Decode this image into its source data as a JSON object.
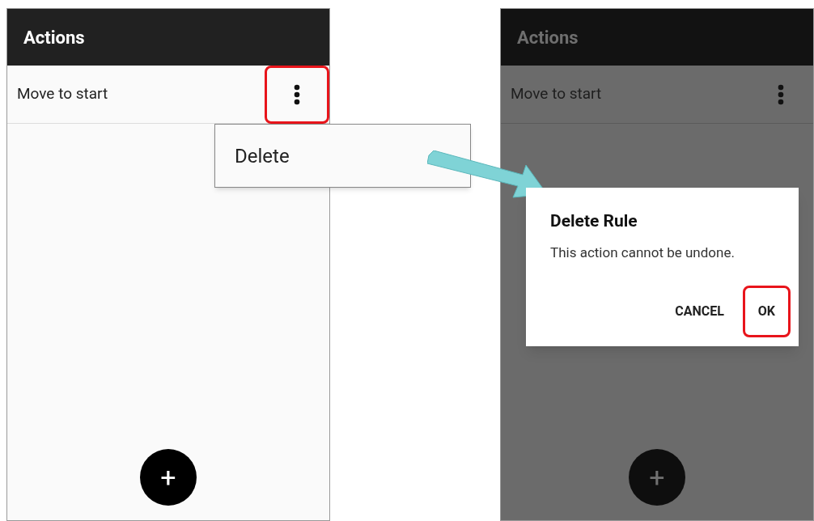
{
  "left_screen": {
    "title": "Actions",
    "rows": [
      {
        "label": "Move to start",
        "menu_highlighted": true
      }
    ],
    "menu": {
      "items": [
        "Delete"
      ]
    },
    "fab": "+"
  },
  "right_screen": {
    "title": "Actions",
    "rows": [
      {
        "label": "Move to start",
        "menu_highlighted": false
      }
    ],
    "dialog": {
      "title": "Delete Rule",
      "message": "This action cannot be undone.",
      "buttons": [
        {
          "label": "CANCEL",
          "highlighted": false
        },
        {
          "label": "OK",
          "highlighted": true
        }
      ]
    },
    "fab": "+"
  }
}
